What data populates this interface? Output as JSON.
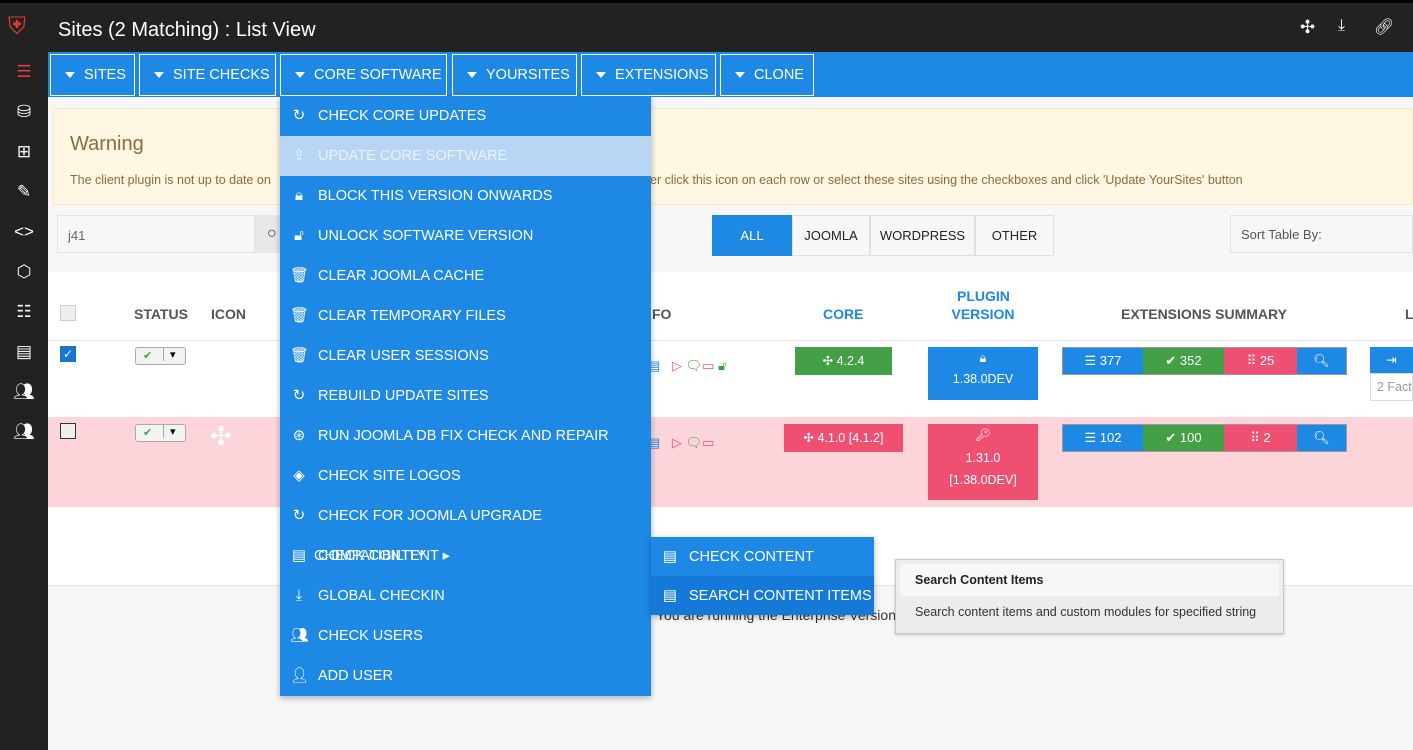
{
  "header": {
    "title": "Sites (2 Matching) : List View",
    "right_icons": [
      "joomla-icon",
      "download-icon",
      "link-icon"
    ]
  },
  "sidebar": {
    "icons": [
      "menu-icon",
      "database-icon",
      "grid-icon",
      "edit-icon",
      "code-icon",
      "hexagon-icon",
      "list-icon",
      "document-icon",
      "users-icon",
      "users-icon"
    ]
  },
  "toolbar": {
    "buttons": [
      "SITES",
      "SITE CHECKS",
      "CORE SOFTWARE",
      "YOURSITES",
      "EXTENSIONS",
      "CLONE"
    ]
  },
  "warning": {
    "title": "Warning",
    "text_left": "The client plugin is not up to date on",
    "text_right": "er click this icon on each row or select these sites using the checkboxes and click 'Update YourSites' button"
  },
  "search": {
    "value": "j41"
  },
  "filters": {
    "items": [
      "ALL",
      "JOOMLA",
      "WORDPRESS",
      "OTHER"
    ],
    "active": "ALL"
  },
  "sort": {
    "label": "Sort Table By:"
  },
  "table": {
    "headers": {
      "status": "STATUS",
      "icon": "ICON",
      "info": "FO",
      "core": "CORE",
      "plugin1": "PLUGIN",
      "plugin2": "VERSION",
      "ext": "EXTENSIONS SUMMARY",
      "last": "L"
    },
    "rows": [
      {
        "checked": true,
        "core": "4.2.4",
        "core_status": "ok",
        "plugin": "1.38.0DEV",
        "plugin_extra": "",
        "ext_total": "377",
        "ext_ok": "352",
        "ext_updates": "25",
        "extra": "2 Fact"
      },
      {
        "checked": false,
        "core": "4.1.0 [4.1.2]",
        "core_status": "outdated",
        "plugin": "1.31.0",
        "plugin_extra": "[1.38.0DEV]",
        "ext_total": "102",
        "ext_ok": "100",
        "ext_updates": "2",
        "extra": ""
      }
    ]
  },
  "footer": {
    "text": "You are running the Enterprise Version"
  },
  "menu": {
    "items": [
      {
        "label": "CHECK CORE UPDATES",
        "icon": "↻"
      },
      {
        "label": "UPDATE CORE SOFTWARE",
        "icon": "⇪"
      },
      {
        "label": "BLOCK THIS VERSION ONWARDS",
        "icon": "🔒︎"
      },
      {
        "label": "UNLOCK SOFTWARE VERSION",
        "icon": "🔓︎"
      },
      {
        "label": "CLEAR JOOMLA CACHE",
        "icon": "🗑︎"
      },
      {
        "label": "CLEAR TEMPORARY FILES",
        "icon": "🗑︎"
      },
      {
        "label": "CLEAR USER SESSIONS",
        "icon": "🗑︎"
      },
      {
        "label": "REBUILD UPDATE SITES",
        "icon": "↻"
      },
      {
        "label": "RUN JOOMLA DB FIX CHECK AND REPAIR",
        "icon": "⊛"
      },
      {
        "label": "CHECK SITE LOGOS",
        "icon": "◈"
      },
      {
        "label": "CHECK FOR JOOMLA UPGRADE COMPATIBILITY",
        "icon": "↻"
      },
      {
        "label": "CHECK CONTENT ▸",
        "icon": "▤"
      },
      {
        "label": "GLOBAL CHECKIN",
        "icon": "⤓"
      },
      {
        "label": "CHECK USERS",
        "icon": "👥︎"
      },
      {
        "label": "ADD USER",
        "icon": "👤︎"
      }
    ],
    "hovered": "UPDATE CORE SOFTWARE"
  },
  "submenu": {
    "items": [
      "CHECK CONTENT",
      "SEARCH CONTENT ITEMS"
    ],
    "selected": "SEARCH CONTENT ITEMS"
  },
  "tooltip": {
    "title": "Search Content Items",
    "description": "Search content items and custom modules for specified string"
  },
  "colors": {
    "primary": "#1e88e5",
    "success": "#43a047",
    "danger": "#ef5071",
    "row_warning": "#fcd4da"
  }
}
